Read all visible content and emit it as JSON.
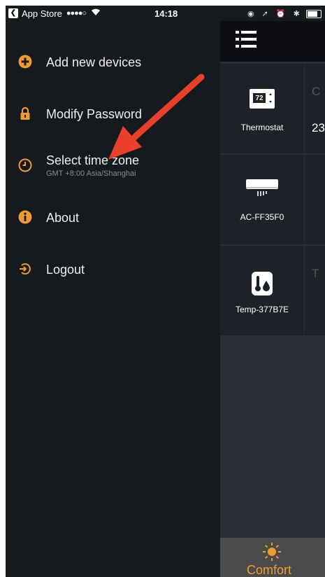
{
  "status_bar": {
    "back_app": "App Store",
    "signal": "●●●●○",
    "time": "14:18"
  },
  "drawer": {
    "items": [
      {
        "label": "Add new devices",
        "icon": "plus-circle-icon"
      },
      {
        "label": "Modify Password",
        "icon": "lock-icon"
      },
      {
        "label": "Select time zone",
        "sublabel": "GMT +8:00  Asia/Shanghai",
        "icon": "clock-icon"
      },
      {
        "label": "About",
        "icon": "info-icon"
      },
      {
        "label": "Logout",
        "icon": "logout-icon"
      }
    ]
  },
  "devices": [
    {
      "name": "Thermostat",
      "icon_text": "72",
      "peek_top": "C",
      "peek_value": "23"
    },
    {
      "name": "AC-FF35F0"
    },
    {
      "name": "Temp-377B7E",
      "peek_top": "T"
    }
  ],
  "tabbar": {
    "active_label": "Comfort"
  },
  "colors": {
    "accent": "#f09b31",
    "drawer_bg": "#16191d",
    "arrow": "#e8402a"
  }
}
